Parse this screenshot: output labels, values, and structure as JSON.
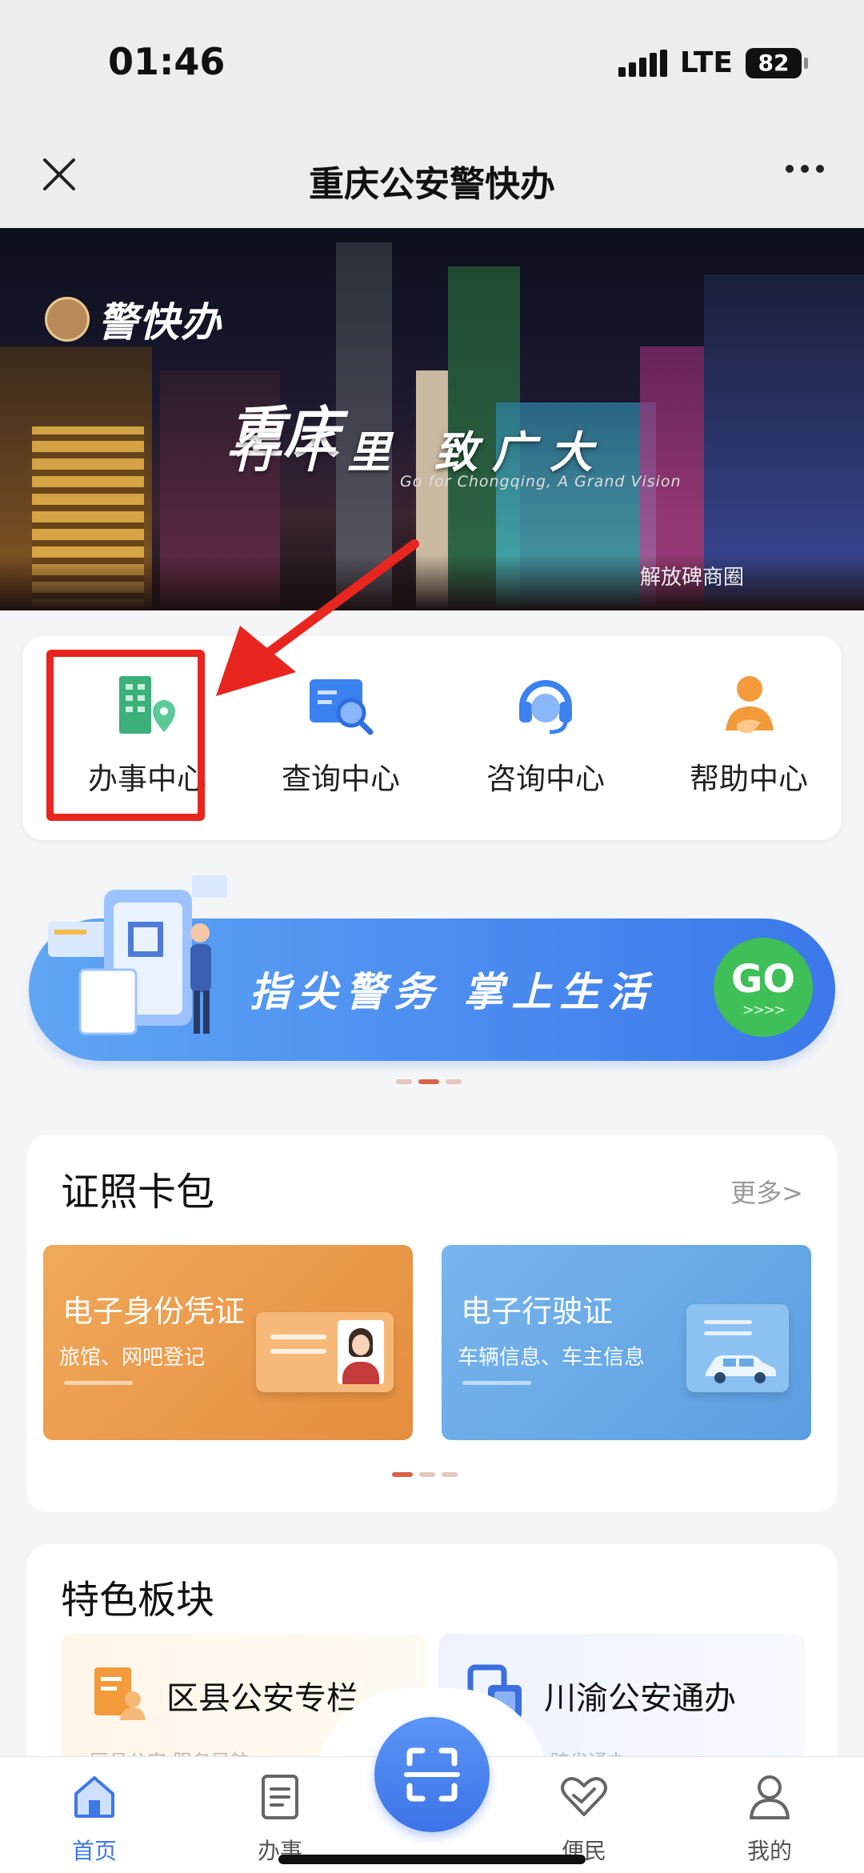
{
  "status": {
    "time": "01:46",
    "network": "LTE",
    "battery": "82"
  },
  "nav": {
    "title": "重庆公安警快办",
    "close_icon": "close-icon",
    "more_icon": "more-dots-icon"
  },
  "banner": {
    "logo_text": "警快办",
    "slogan_left": "重庆",
    "slogan": "行千里 致广大",
    "slogan_en": "Go for Chongqing, A Grand Vision",
    "location_tag": "解放碑商圈"
  },
  "services": [
    {
      "label": "办事中心",
      "icon": "building-location-icon",
      "color": "#3bb07a"
    },
    {
      "label": "查询中心",
      "icon": "search-document-icon",
      "color": "#3b82f0"
    },
    {
      "label": "咨询中心",
      "icon": "headset-icon",
      "color": "#3b82f0"
    },
    {
      "label": "帮助中心",
      "icon": "helping-hand-icon",
      "color": "#f39a3b"
    }
  ],
  "promo": {
    "text": "指尖警务 掌上生活",
    "go": "GO",
    "go_sub": ">>>>"
  },
  "wallet": {
    "title": "证照卡包",
    "more": "更多>",
    "cards": [
      {
        "title": "电子身份凭证",
        "subtitle": "旅馆、网吧登记",
        "color": "#ec9b4b"
      },
      {
        "title": "电子行驶证",
        "subtitle": "车辆信息、车主信息",
        "color": "#6aa9e8"
      }
    ]
  },
  "featured": {
    "title": "特色板块",
    "tiles": [
      {
        "title": "区县公安专栏",
        "subtitle": "区县公安 服务导航"
      },
      {
        "title": "川渝公安通办",
        "subtitle": "川渝公安 跨省通办"
      }
    ]
  },
  "tabbar": {
    "tabs": [
      {
        "label": "首页",
        "icon": "home-icon"
      },
      {
        "label": "办事",
        "icon": "document-icon"
      },
      {
        "label": "便民",
        "icon": "heart-icon"
      },
      {
        "label": "我的",
        "icon": "user-icon"
      }
    ],
    "scan_icon": "scan-icon"
  },
  "colors": {
    "accent": "#3c78e8",
    "highlight": "#e8251e"
  }
}
